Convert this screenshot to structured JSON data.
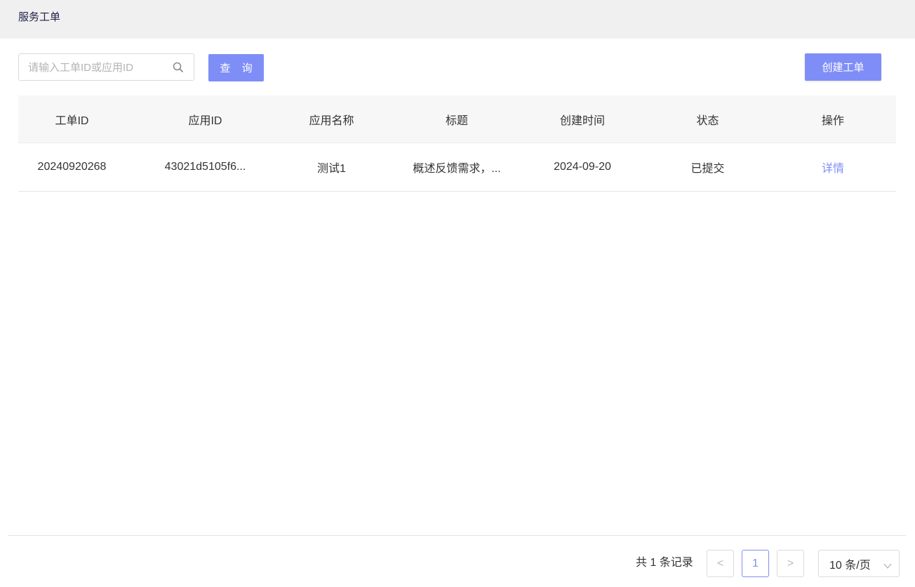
{
  "header": {
    "title": "服务工单"
  },
  "search": {
    "placeholder": "请输入工单ID或应用ID",
    "value": ""
  },
  "buttons": {
    "query": "查 询",
    "create": "创建工单"
  },
  "table": {
    "columns": [
      "工单ID",
      "应用ID",
      "应用名称",
      "标题",
      "创建时间",
      "状态",
      "操作"
    ],
    "rows": [
      {
        "ticket_id": "20240920268",
        "app_id": "43021d5105f6...",
        "app_name": "测试1",
        "title": "概述反馈需求，...",
        "created": "2024-09-20",
        "status": "已提交",
        "action": "详情"
      }
    ]
  },
  "pagination": {
    "total_text": "共 1 条记录",
    "prev": "<",
    "next": ">",
    "current_page": "1",
    "page_size": "10 条/页"
  },
  "colors": {
    "accent": "#7f8ef7",
    "header_bg": "#f0f0f0",
    "table_head_bg": "#f7f7f8"
  },
  "icons": [
    "search-icon",
    "chevron-left-icon",
    "chevron-right-icon",
    "chevron-down-icon"
  ]
}
